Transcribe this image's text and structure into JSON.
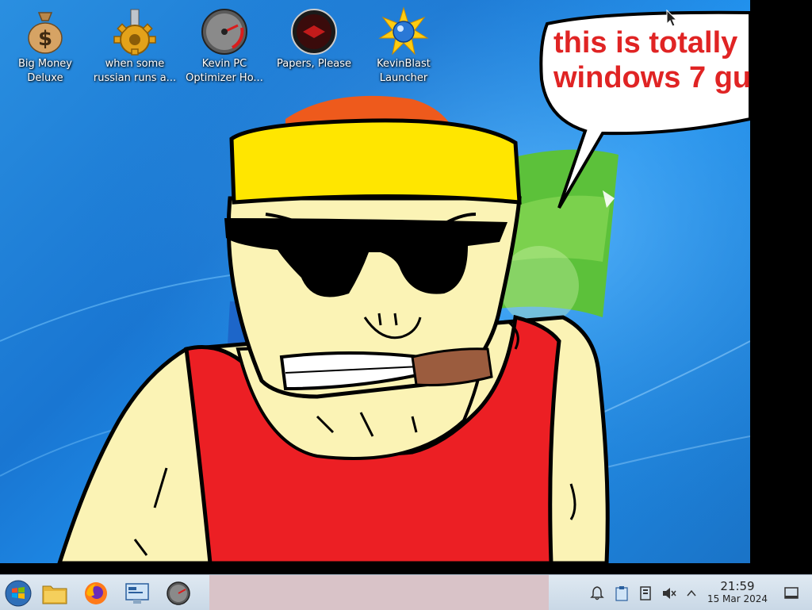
{
  "desktop": {
    "icons": [
      {
        "name": "big-money-deluxe",
        "label_line1": "Big Money",
        "label_line2": "Deluxe",
        "icon": "money-bag-icon"
      },
      {
        "name": "russian",
        "label_line1": "when some",
        "label_line2": "russian runs a...",
        "icon": "gear-icon"
      },
      {
        "name": "kevin-pc-optimizer",
        "label_line1": "Kevin PC",
        "label_line2": "Optimizer Ho...",
        "icon": "speedometer-icon"
      },
      {
        "name": "papers-please",
        "label_line1": "Papers, Please",
        "label_line2": "",
        "icon": "papers-please-icon"
      },
      {
        "name": "kevinblast-launcher",
        "label_line1": "KevinBlast",
        "label_line2": "Launcher",
        "icon": "starburst-icon"
      }
    ],
    "speech_bubble": {
      "line1": "this is totally",
      "line2": "windows 7 gu"
    }
  },
  "taskbar": {
    "buttons": [
      "start-button",
      "file-manager",
      "firefox",
      "system-settings",
      "optimizer"
    ],
    "clock": {
      "time": "21:59",
      "date": "15 Mar 2024"
    }
  },
  "colors": {
    "taskbar": "#d3e0ec",
    "active_window": "#d9c3c8",
    "bubble_text": "#e02424",
    "headband": "#ffe600",
    "tank_top": "#ec1f24",
    "skin": "#fbf3b5"
  }
}
